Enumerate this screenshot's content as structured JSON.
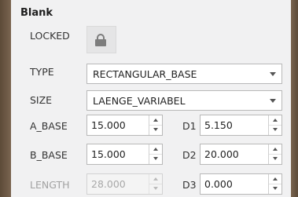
{
  "section": {
    "title": "Blank"
  },
  "locked": {
    "label": "LOCKED",
    "icon": "lock-icon"
  },
  "type": {
    "label": "TYPE",
    "value": "RECTANGULAR_BASE"
  },
  "size": {
    "label": "SIZE",
    "value": "LAENGE_VARIABEL"
  },
  "a_base": {
    "label": "A_BASE",
    "value": "15.000"
  },
  "b_base": {
    "label": "B_BASE",
    "value": "15.000"
  },
  "length": {
    "label": "LENGTH",
    "value": "28.000"
  },
  "d1": {
    "label": "D1",
    "value": "5.150"
  },
  "d2": {
    "label": "D2",
    "value": "20.000"
  },
  "d3": {
    "label": "D3",
    "value": "0.000"
  }
}
